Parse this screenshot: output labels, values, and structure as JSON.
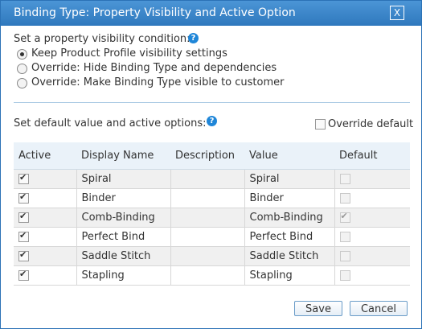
{
  "dialog": {
    "title": "Binding Type: Property Visibility and Active Option",
    "close_label": "X"
  },
  "visibility": {
    "label": "Set a property visibility condition:",
    "options": [
      {
        "label": "Keep Product Profile visibility settings",
        "selected": true
      },
      {
        "label": "Override: Hide Binding Type and dependencies",
        "selected": false
      },
      {
        "label": "Override: Make Binding Type visible to customer",
        "selected": false
      }
    ]
  },
  "defaults": {
    "label": "Set default value and active options:",
    "override_label": "Override default",
    "override_checked": false
  },
  "table": {
    "headers": [
      "Active",
      "Display Name",
      "Description",
      "Value",
      "Default"
    ],
    "rows": [
      {
        "active": true,
        "display_name": "Spiral",
        "description": "",
        "value": "Spiral",
        "default": false
      },
      {
        "active": true,
        "display_name": "Binder",
        "description": "",
        "value": "Binder",
        "default": false
      },
      {
        "active": true,
        "display_name": "Comb-Binding",
        "description": "",
        "value": "Comb-Binding",
        "default": true
      },
      {
        "active": true,
        "display_name": "Perfect Bind",
        "description": "",
        "value": "Perfect Bind",
        "default": false
      },
      {
        "active": true,
        "display_name": "Saddle Stitch",
        "description": "",
        "value": "Saddle Stitch",
        "default": false
      },
      {
        "active": true,
        "display_name": "Stapling",
        "description": "",
        "value": "Stapling",
        "default": false
      }
    ]
  },
  "buttons": {
    "save": "Save",
    "cancel": "Cancel"
  },
  "icons": {
    "help": "help-icon",
    "help_glyph": "?",
    "close": "close-icon"
  }
}
